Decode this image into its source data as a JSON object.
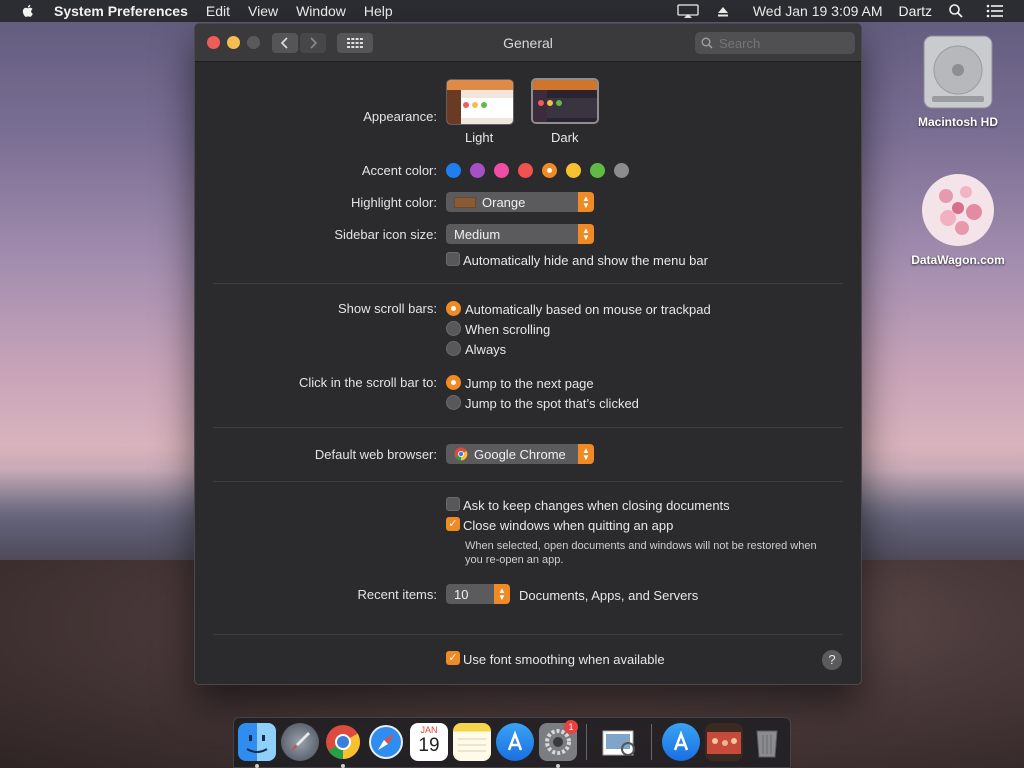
{
  "menubar": {
    "app_name": "System Preferences",
    "menus": [
      "Edit",
      "View",
      "Window",
      "Help"
    ],
    "clock": "Wed Jan 19  3:09 AM",
    "user": "Dartz"
  },
  "window": {
    "title": "General",
    "search_placeholder": "Search"
  },
  "appearance": {
    "label": "Appearance:",
    "options": [
      {
        "name": "Light"
      },
      {
        "name": "Dark",
        "selected": true
      }
    ]
  },
  "accent": {
    "label": "Accent color:",
    "colors": [
      "#1f7ef0",
      "#a550c4",
      "#f04ea5",
      "#f0524f",
      "#f08a24",
      "#f6c02f",
      "#62ba46",
      "#8c8c8c"
    ],
    "selected_index": 4
  },
  "highlight": {
    "label": "Highlight color:",
    "value": "Orange",
    "swatch": "#8a5a34"
  },
  "sidebar_size": {
    "label": "Sidebar icon size:",
    "value": "Medium"
  },
  "menu_bar_auto_hide": {
    "label": "Automatically hide and show the menu bar",
    "checked": false
  },
  "scroll_bars": {
    "label": "Show scroll bars:",
    "options": [
      "Automatically based on mouse or trackpad",
      "When scrolling",
      "Always"
    ],
    "selected_index": 0
  },
  "click_scroll": {
    "label": "Click in the scroll bar to:",
    "options": [
      "Jump to the next page",
      "Jump to the spot that’s clicked"
    ],
    "selected_index": 0
  },
  "browser": {
    "label": "Default web browser:",
    "value": "Google Chrome"
  },
  "ask_keep_changes": {
    "label": "Ask to keep changes when closing documents",
    "checked": false
  },
  "close_windows": {
    "label": "Close windows when quitting an app",
    "checked": true,
    "note": "When selected, open documents and windows will not be restored when you re-open an app."
  },
  "recent_items": {
    "label": "Recent items:",
    "value": "10",
    "suffix": "Documents, Apps, and Servers"
  },
  "font_smoothing": {
    "label": "Use font smoothing when available",
    "checked": true
  },
  "help_label": "?",
  "desktop": {
    "icons": [
      {
        "name": "Macintosh HD"
      },
      {
        "name": "DataWagon.com"
      }
    ]
  },
  "dock": {
    "apps": [
      "Finder",
      "Launchpad",
      "Google Chrome",
      "Safari",
      "Calendar",
      "Notes",
      "App Store",
      "System Preferences",
      "Preview",
      "Applications",
      "Photos",
      "Trash"
    ],
    "calendar_month": "JAN",
    "calendar_day": "19",
    "badge": "1"
  },
  "colors": {
    "accent": "#f08a24",
    "window_bg": "#2b2b2d"
  }
}
